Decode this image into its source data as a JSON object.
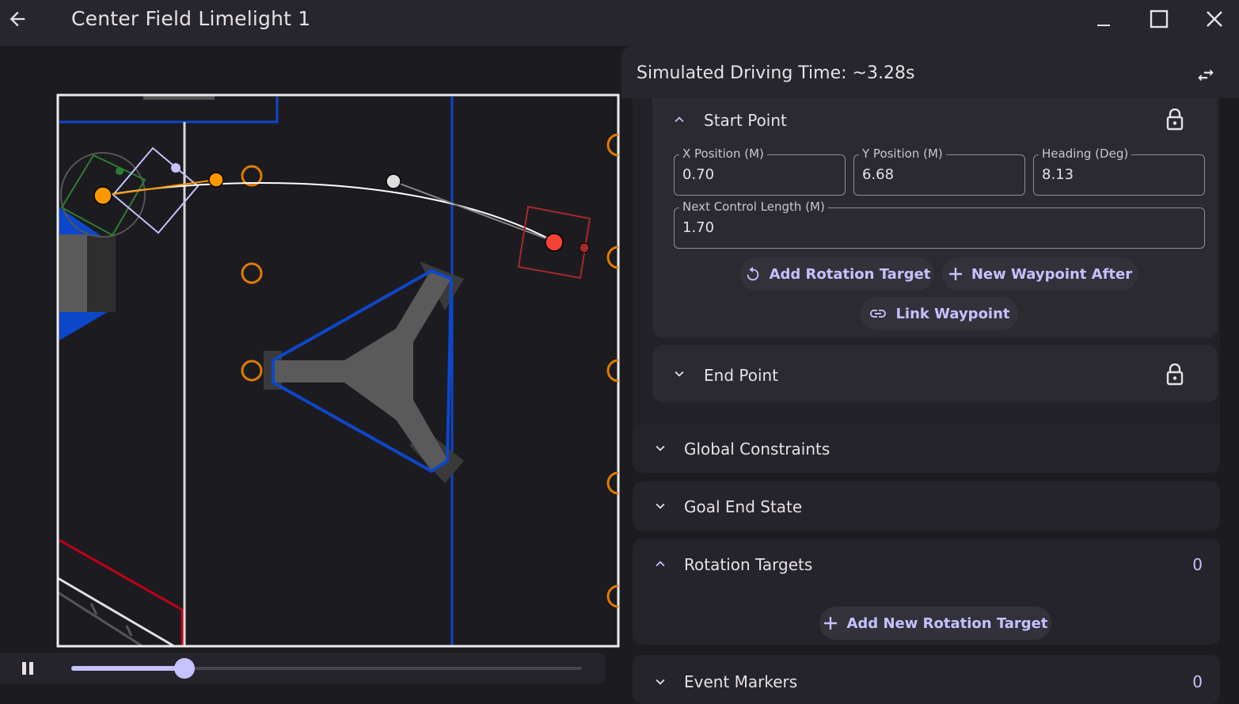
{
  "window": {
    "title": "Center Field Limelight 1"
  },
  "sidebar": {
    "sim_time": "Simulated Driving Time: ~3.28s",
    "start_point": {
      "label": "Start Point",
      "x_label": "X Position (M)",
      "x_value": "0.70",
      "y_label": "Y Position (M)",
      "y_value": "6.68",
      "heading_label": "Heading (Deg)",
      "heading_value": "8.13",
      "control_label": "Next Control Length (M)",
      "control_value": "1.70",
      "add_rotation_label": "Add Rotation Target",
      "new_waypoint_label": "New Waypoint After",
      "link_waypoint_label": "Link Waypoint"
    },
    "end_point": {
      "label": "End Point"
    },
    "global_constraints": {
      "label": "Global Constraints"
    },
    "goal_end_state": {
      "label": "Goal End State"
    },
    "rotation_targets": {
      "label": "Rotation Targets",
      "count": "0",
      "add_label": "Add New Rotation Target"
    },
    "event_markers": {
      "label": "Event Markers",
      "count": "0"
    }
  },
  "playback": {
    "state": "playing",
    "progress": 0.222
  },
  "icons": {
    "back": "arrow-left-icon",
    "minimize": "minimize-icon",
    "maximize": "maximize-icon",
    "close": "close-icon",
    "swap": "swap-horizontal-icon",
    "lock": "lock-icon",
    "rotate": "rotate-left-icon",
    "add": "plus-icon",
    "link": "link-icon",
    "pause": "pause-icon"
  },
  "colors": {
    "accent": "#c4c2ff",
    "path_line": "#ffffff",
    "start_waypoint": "#ff9800",
    "end_waypoint": "#f44336",
    "field_blue": "#0d47c9",
    "field_red": "#c00018",
    "game_piece": "#e07b00"
  }
}
